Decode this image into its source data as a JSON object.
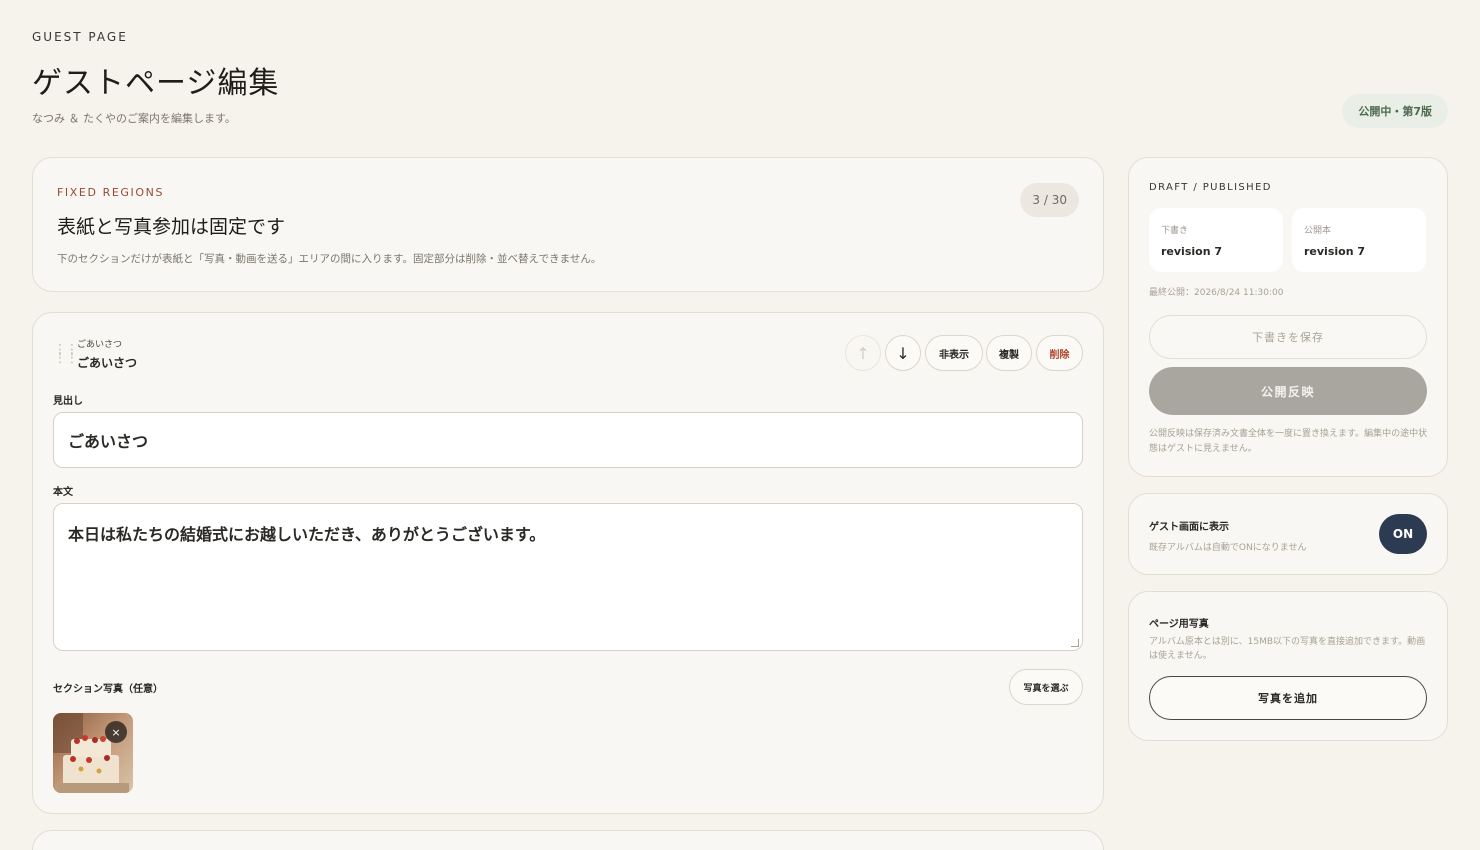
{
  "header": {
    "eyebrow": "GUEST PAGE",
    "title": "ゲストページ編集",
    "subtitle": "なつみ ＆ たくやのご案内を編集します。",
    "status": "公開中・第7版"
  },
  "fixed_regions": {
    "label": "FIXED REGIONS",
    "title": "表紙と写真参加は固定です",
    "description": "下のセクションだけが表紙と「写真・動画を送る」エリアの間に入ります。固定部分は削除・並べ替えできません。",
    "counter": "3 / 30"
  },
  "section": {
    "type_label": "ごあいさつ",
    "name": "ごあいさつ",
    "controls": {
      "up": "↑",
      "down": "↓",
      "hide": "非表示",
      "duplicate": "複製",
      "delete": "削除"
    },
    "heading_label": "見出し",
    "heading_value": "ごあいさつ",
    "body_label": "本文",
    "body_value": "本日は私たちの結婚式にお越しいただき、ありがとうございます。",
    "photo_label": "セクション写真（任意）",
    "pick_photo": "写真を選ぶ",
    "remove_photo": "×"
  },
  "draft_panel": {
    "label": "DRAFT / PUBLISHED",
    "draft_key": "下書き",
    "draft_value": "revision 7",
    "published_key": "公開本",
    "published_value": "revision 7",
    "last_published": "最終公開：2026/8/24 11:30:00",
    "save_draft": "下書きを保存",
    "publish": "公開反映",
    "note": "公開反映は保存済み文書全体を一度に置き換えます。編集中の途中状態はゲストに見えません。"
  },
  "guest_display": {
    "title": "ゲスト画面に表示",
    "subtitle": "既存アルバムは自動でONになりません",
    "toggle": "ON"
  },
  "page_photos": {
    "title": "ページ用写真",
    "description": "アルバム原本とは別に、15MB以下の写真を直接追加できます。動画は使えません。",
    "add": "写真を追加"
  },
  "colors": {
    "background": "#f6f2ec",
    "accent_red": "#9a4a33",
    "toggle_on": "#2c3a52",
    "status_green": "#4d6a50"
  }
}
